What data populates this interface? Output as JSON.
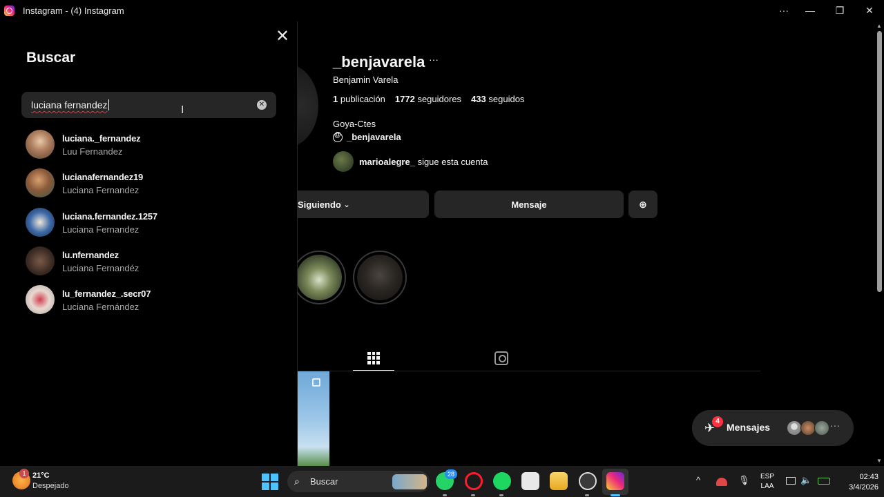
{
  "window": {
    "title": "Instagram - (4) Instagram",
    "controls": {
      "more": "···",
      "minimize": "—",
      "maximize": "❐",
      "close": "✕"
    }
  },
  "search_panel": {
    "title": "Buscar",
    "close_icon": "✕",
    "input_value": "luciana fernandez",
    "clear_icon": "✕",
    "results": [
      {
        "username": "luciana._fernandez",
        "full_name": "Luu Fernandez"
      },
      {
        "username": "lucianafernandez19",
        "full_name": "Luciana Fernandez"
      },
      {
        "username": "luciana.fernandez.1257",
        "full_name": "Luciana Fernandez"
      },
      {
        "username": "lu.nfernandez",
        "full_name": "Luciana Fernandéz"
      },
      {
        "username": "lu_fernandez_.secr07",
        "full_name": "Luciana Fernández"
      }
    ]
  },
  "profile": {
    "username": "_benjavarela",
    "options_icon": "···",
    "full_name": "Benjamin Varela",
    "stats": {
      "posts_count": "1",
      "posts_label": "publicación",
      "followers_count": "1772",
      "followers_label": "seguidores",
      "following_count": "433",
      "following_label": "seguidos"
    },
    "location": "Goya-Ctes",
    "threads_handle": "_benjavarela",
    "followed_by_user": "marioalegre_",
    "followed_by_text": "sigue esta cuenta",
    "buttons": {
      "following": "Siguiendo",
      "following_chevron": "⌄",
      "message": "Mensaje",
      "suggest_icon": "⊕"
    }
  },
  "messages_widget": {
    "label": "Mensajes",
    "badge": "4",
    "more": "···"
  },
  "taskbar": {
    "weather_badge": "1",
    "temperature": "21°C",
    "weather": "Despejado",
    "search_label": "Buscar",
    "whatsapp_badge": "28",
    "tray_chevron": "^",
    "lang_top": "ESP",
    "lang_bottom": "LAA",
    "time": "02:43",
    "date": "3/4/2026"
  }
}
